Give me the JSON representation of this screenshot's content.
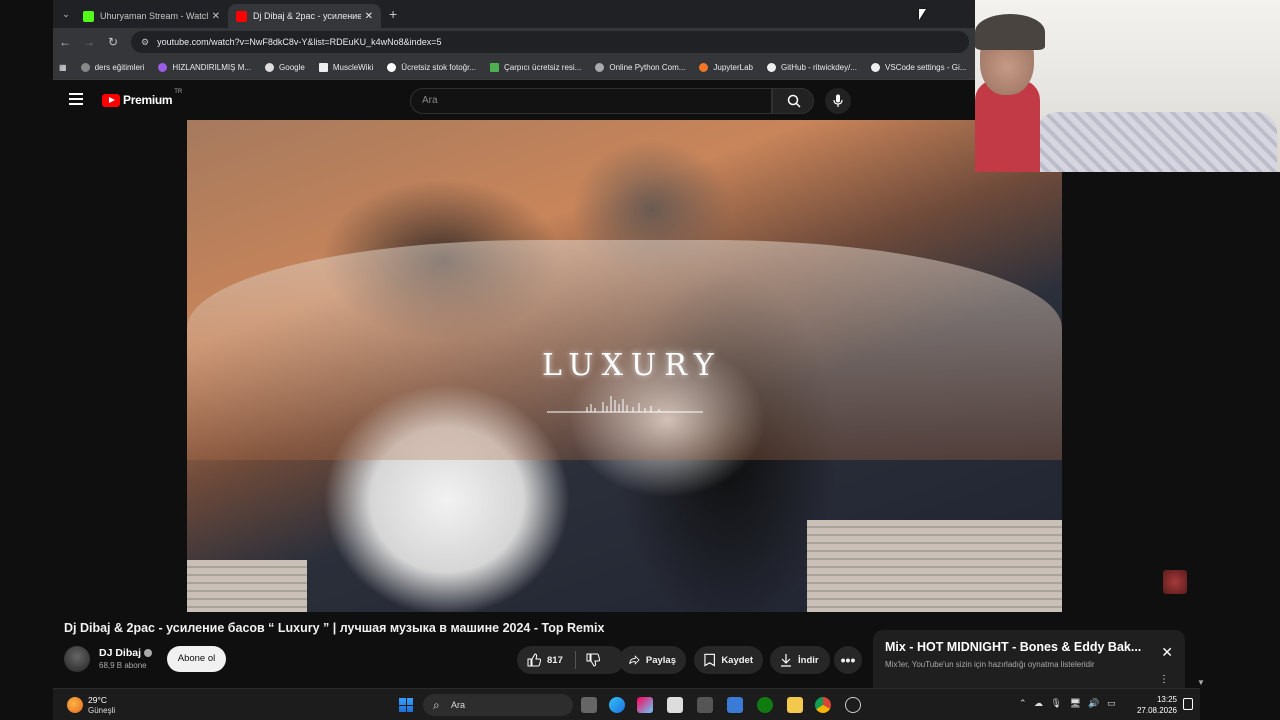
{
  "browser": {
    "tabs": [
      {
        "title": "Uhuryaman Stream - Watch Liv",
        "favicon_color": "#53fc18",
        "active": false
      },
      {
        "title": "Dj Dibaj & 2pac - усиление",
        "favicon_color": "#ff0000",
        "active": true
      }
    ],
    "new_tab_symbol": "+",
    "url": "youtube.com/watch?v=NwF8dkC8v-Y&list=RDEuKU_k4wNo8&index=5",
    "bookmarks": [
      "ders eğitimleri",
      "HIZLANDIRILMIŞ M...",
      "Google",
      "MuscleWiki",
      "Ücretsiz stok fotoğr...",
      "Çarpıcı ücretsiz resi...",
      "Online Python Com...",
      "JupyterLab",
      "GitHub - ritwickdey/...",
      "VSCode settings - Gi..."
    ]
  },
  "youtube": {
    "logo_text": "Premium",
    "region": "TR",
    "search_placeholder": "Ara",
    "video_overlay_text": "LUXURY",
    "video_title": "Dj Dibaj & 2pac - усиление басов “ Luxury ” | лучшая музыка в машине 2024 - Top Remix",
    "channel_name": "DJ Dibaj",
    "subscribers": "68,9 B abone",
    "subscribe_label": "Abone ol",
    "like_count": "817",
    "share_label": "Paylaş",
    "save_label": "Kaydet",
    "download_label": "İndir",
    "mix_title": "Mix - HOT MIDNIGHT - Bones & Eddy Bak...",
    "mix_subtitle": "Mix'ler, YouTube'un sizin için hazırladığı oynatma listeleridir"
  },
  "taskbar": {
    "temperature": "29°C",
    "weather": "Güneşli",
    "search_placeholder": "Ara",
    "time": "13:25",
    "date": "27.08.2026"
  },
  "colors": {
    "yt_red": "#ff0000",
    "background": "#0f0f0f"
  }
}
